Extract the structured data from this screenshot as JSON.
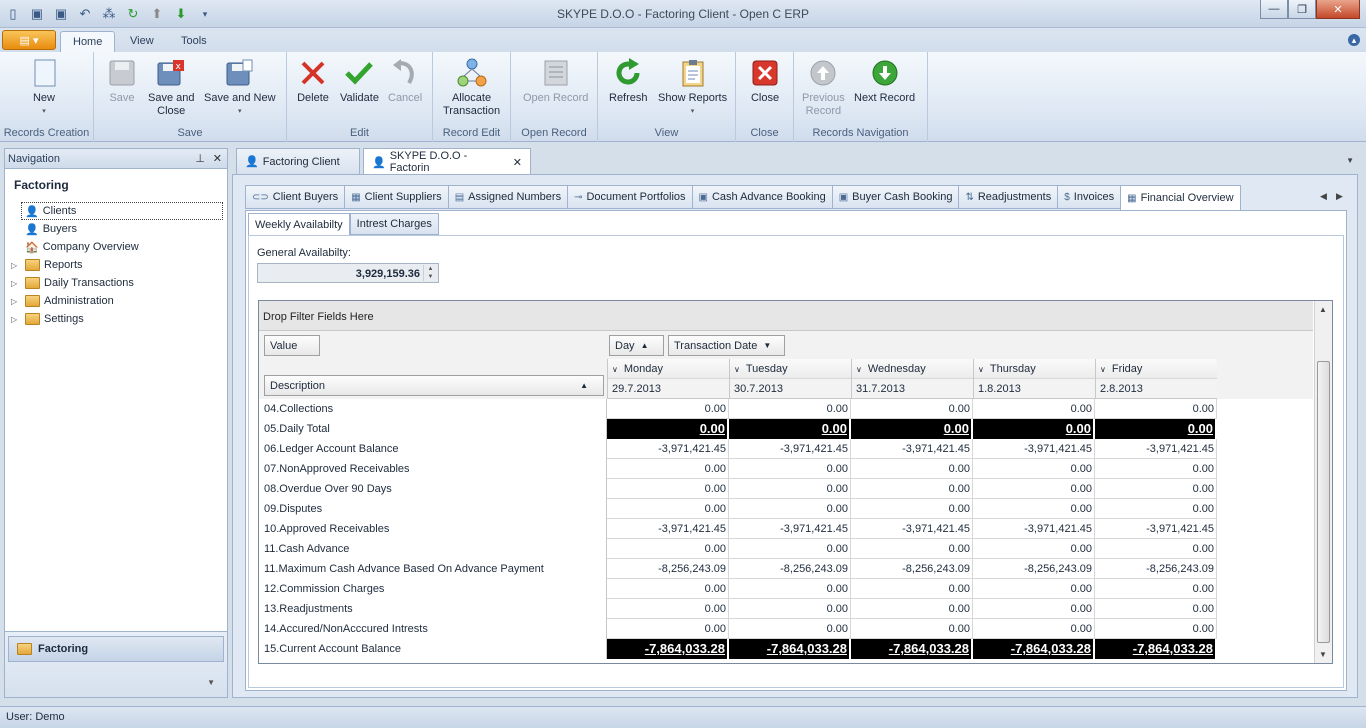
{
  "window": {
    "title": "SKYPE D.O.O - Factoring Client - Open C ERP",
    "minimize": "—",
    "maximize": "❐",
    "close": "✕"
  },
  "ribbon_tabs": [
    "Home",
    "View",
    "Tools"
  ],
  "ribbon": {
    "groups": {
      "records_creation": "Records Creation",
      "save": "Save",
      "edit": "Edit",
      "record_edit": "Record Edit",
      "open_record": "Open Record",
      "view": "View",
      "close": "Close",
      "records_navigation": "Records Navigation"
    },
    "buttons": {
      "new": "New",
      "save": "Save",
      "save_and_close_1": "Save and",
      "save_and_close_2": "Close",
      "save_and_new": "Save and New",
      "delete": "Delete",
      "validate": "Validate",
      "cancel": "Cancel",
      "allocate_1": "Allocate",
      "allocate_2": "Transaction",
      "open_record": "Open Record",
      "refresh": "Refresh",
      "show_reports": "Show Reports",
      "close": "Close",
      "previous_1": "Previous",
      "previous_2": "Record",
      "next_record": "Next Record"
    }
  },
  "navigation": {
    "title": "Navigation",
    "section": "Factoring",
    "items": [
      {
        "label": "Clients",
        "type": "user"
      },
      {
        "label": "Buyers",
        "type": "user"
      },
      {
        "label": "Company Overview",
        "type": "company"
      },
      {
        "label": "Reports",
        "type": "folder"
      },
      {
        "label": "Daily Transactions",
        "type": "folder"
      },
      {
        "label": "Administration",
        "type": "folder"
      },
      {
        "label": "Settings",
        "type": "folder"
      }
    ],
    "group_button": "Factoring"
  },
  "doc_tabs": [
    "Factoring Client",
    "SKYPE D.O.O - Factorin"
  ],
  "sub_tabs": [
    "Client Buyers",
    "Client Suppliers",
    "Assigned Numbers",
    "Document Portfolios",
    "Cash Advance Booking",
    "Buyer Cash Booking",
    "Readjustments",
    "Invoices",
    "Financial Overview"
  ],
  "inner_tabs": [
    "Weekly Availabilty",
    "Intrest Charges"
  ],
  "general_availability": {
    "label": "General Availabilty:",
    "value": "3,929,159.36"
  },
  "pivot": {
    "filter_hint": "Drop Filter Fields Here",
    "value_field": "Value",
    "row_field": "Description",
    "col_fields": [
      "Day",
      "Transaction Date"
    ],
    "days": [
      {
        "day": "Monday",
        "date": "29.7.2013"
      },
      {
        "day": "Tuesday",
        "date": "30.7.2013"
      },
      {
        "day": "Wednesday",
        "date": "31.7.2013"
      },
      {
        "day": "Thursday",
        "date": "1.8.2013"
      },
      {
        "day": "Friday",
        "date": "2.8.2013"
      }
    ],
    "rows": [
      {
        "label": "04.Collections",
        "values": [
          "0.00",
          "0.00",
          "0.00",
          "0.00",
          "0.00"
        ],
        "highlight": false
      },
      {
        "label": "05.Daily Total",
        "values": [
          "0.00",
          "0.00",
          "0.00",
          "0.00",
          "0.00"
        ],
        "highlight": true
      },
      {
        "label": "06.Ledger Account Balance",
        "values": [
          "-3,971,421.45",
          "-3,971,421.45",
          "-3,971,421.45",
          "-3,971,421.45",
          "-3,971,421.45"
        ],
        "highlight": false
      },
      {
        "label": "07.NonApproved Receivables",
        "values": [
          "0.00",
          "0.00",
          "0.00",
          "0.00",
          "0.00"
        ],
        "highlight": false
      },
      {
        "label": "08.Overdue Over 90 Days",
        "values": [
          "0.00",
          "0.00",
          "0.00",
          "0.00",
          "0.00"
        ],
        "highlight": false
      },
      {
        "label": "09.Disputes",
        "values": [
          "0.00",
          "0.00",
          "0.00",
          "0.00",
          "0.00"
        ],
        "highlight": false
      },
      {
        "label": "10.Approved Receivables",
        "values": [
          "-3,971,421.45",
          "-3,971,421.45",
          "-3,971,421.45",
          "-3,971,421.45",
          "-3,971,421.45"
        ],
        "highlight": false
      },
      {
        "label": "11.Cash Advance",
        "values": [
          "0.00",
          "0.00",
          "0.00",
          "0.00",
          "0.00"
        ],
        "highlight": false
      },
      {
        "label": "11.Maximum Cash Advance Based On Advance Payment",
        "values": [
          "-8,256,243.09",
          "-8,256,243.09",
          "-8,256,243.09",
          "-8,256,243.09",
          "-8,256,243.09"
        ],
        "highlight": false
      },
      {
        "label": "12.Commission Charges",
        "values": [
          "0.00",
          "0.00",
          "0.00",
          "0.00",
          "0.00"
        ],
        "highlight": false
      },
      {
        "label": "13.Readjustments",
        "values": [
          "0.00",
          "0.00",
          "0.00",
          "0.00",
          "0.00"
        ],
        "highlight": false
      },
      {
        "label": "14.Accured/NonAcccured Intrests",
        "values": [
          "0.00",
          "0.00",
          "0.00",
          "0.00",
          "0.00"
        ],
        "highlight": false
      },
      {
        "label": "15.Current Account Balance",
        "values": [
          "-7,864,033.28",
          "-7,864,033.28",
          "-7,864,033.28",
          "-7,864,033.28",
          "-7,864,033.28"
        ],
        "highlight": true
      }
    ]
  },
  "status": "User: Demo"
}
